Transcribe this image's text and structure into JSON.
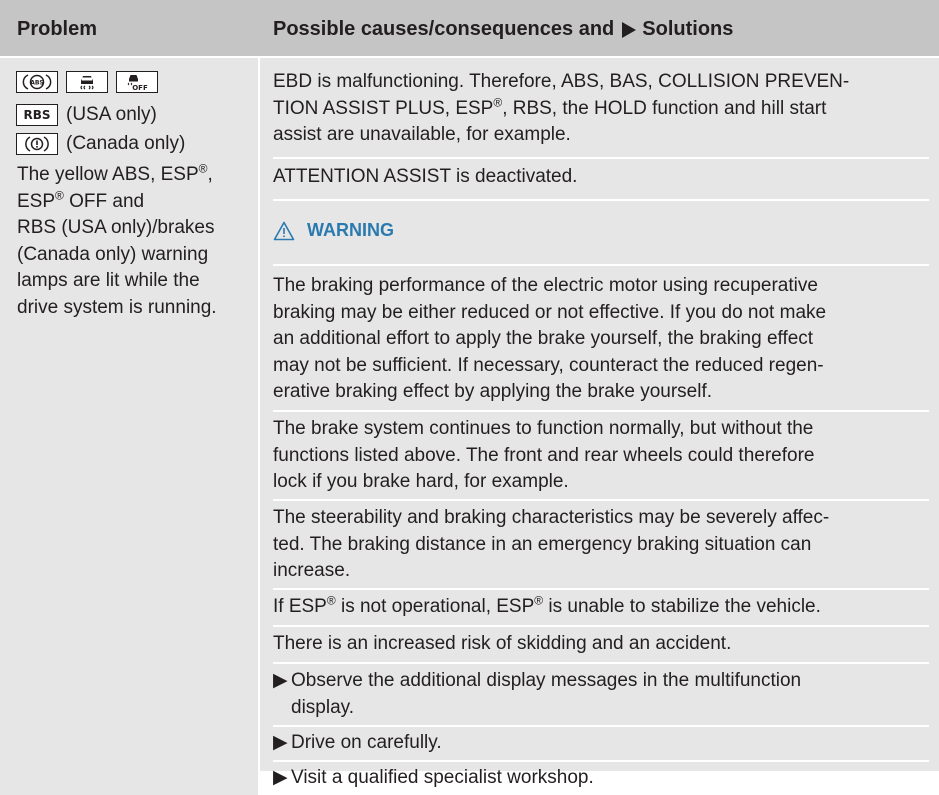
{
  "header": {
    "problem": "Problem",
    "solutions_prefix": "Possible causes/consequences and",
    "solutions_suffix": "Solutions"
  },
  "left": {
    "lamps": [
      {
        "icon": "abs-warning-lamp"
      },
      {
        "icon": "esp-warning-lamp"
      },
      {
        "icon": "esp-off-warning-lamp"
      }
    ],
    "rbs_lamp_label": "RBS",
    "rbs_note": "(USA only)",
    "brake_note": "(Canada only)",
    "desc_lines": [
      "The yellow ABS, ESP®,",
      "ESP® OFF and",
      "RBS (USA only)/brakes",
      "(Canada only) warning",
      "lamps are lit while the",
      "drive system is running."
    ]
  },
  "right": {
    "intro_lines": [
      "EBD is malfunctioning. Therefore, ABS, BAS, COLLISION PREVEN-",
      "TION ASSIST PLUS, ESP®, RBS, the HOLD function and hill start",
      "assist are unavailable, for example."
    ],
    "attention": "ATTENTION ASSIST is deactivated.",
    "warning_label": "WARNING",
    "warning_lines": [
      "The braking performance of the electric motor using recuperative",
      "braking may be either reduced or not effective. If you do not make",
      "an additional effort to apply the brake yourself, the braking effect",
      "may not be sufficient. If necessary, counteract the reduced regen-",
      "erative braking effect by applying the brake yourself."
    ],
    "para1_lines": [
      "The brake system continues to function normally, but without the",
      "functions listed above. The front and rear wheels could therefore",
      "lock if you brake hard, for example."
    ],
    "para2_lines": [
      "The steerability and braking characteristics may be severely affec-",
      "ted. The braking distance in an emergency braking situation can",
      "increase."
    ],
    "para3": "If ESP® is not operational, ESP® is unable to stabilize the vehicle.",
    "para4": "There is an increased risk of skidding and an accident.",
    "bullets": [
      [
        "Observe the additional display messages in the multifunction",
        "display."
      ],
      [
        "Drive on carefully."
      ],
      [
        "Visit a qualified specialist workshop."
      ]
    ]
  },
  "colors": {
    "header_bg": "#c5c5c5",
    "body_bg": "#e6e6e6",
    "warning_blue": "#2a7ab0",
    "text": "#231f20"
  }
}
